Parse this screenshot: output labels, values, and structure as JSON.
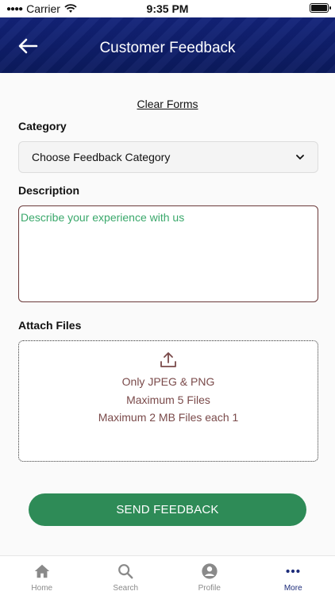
{
  "status_bar": {
    "carrier": "Carrier",
    "time": "9:35 PM"
  },
  "header": {
    "title": "Customer Feedback",
    "back_icon": "arrow-left-icon",
    "bg_color": "#0f1f6e"
  },
  "form": {
    "clear_label": "Clear Forms",
    "category": {
      "label": "Category",
      "selected": "Choose Feedback Category"
    },
    "description": {
      "label": "Description",
      "placeholder": "Describe your experience with us"
    },
    "attach": {
      "label": "Attach Files",
      "icon": "upload-icon",
      "lines": [
        "Only JPEG & PNG",
        "Maximum 5 Files",
        "Maximum 2 MB Files each 1"
      ]
    },
    "submit_label": "SEND FEEDBACK",
    "submit_color": "#2e8b57"
  },
  "tabbar": {
    "items": [
      {
        "label": "Home",
        "icon": "home-icon"
      },
      {
        "label": "Search",
        "icon": "search-icon"
      },
      {
        "label": "Profile",
        "icon": "profile-icon"
      },
      {
        "label": "More",
        "icon": "more-icon",
        "active": true
      }
    ]
  }
}
